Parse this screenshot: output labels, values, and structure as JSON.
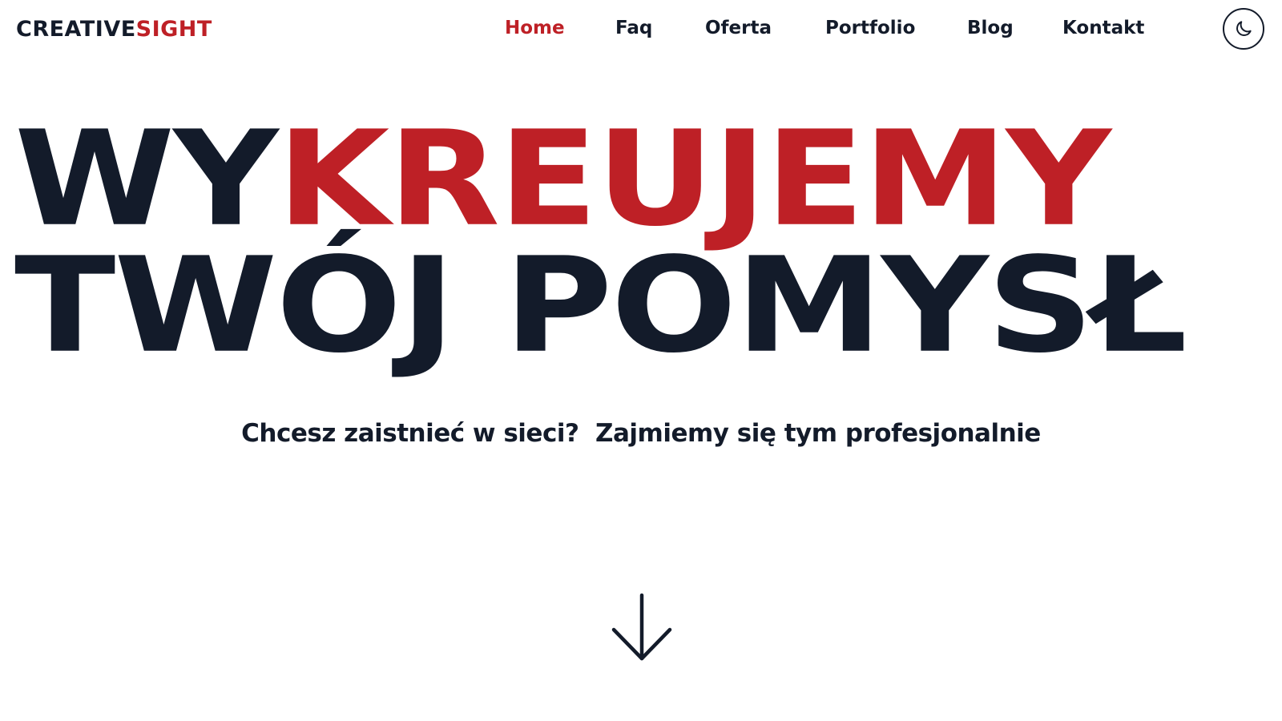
{
  "header": {
    "logo": {
      "part1": "CREATIVE",
      "part2": "SIGHT"
    },
    "nav": [
      {
        "label": "Home",
        "active": true
      },
      {
        "label": "Faq",
        "active": false
      },
      {
        "label": "Oferta",
        "active": false
      },
      {
        "label": "Portfolio",
        "active": false
      },
      {
        "label": "Blog",
        "active": false
      },
      {
        "label": "Kontakt",
        "active": false
      }
    ],
    "theme_toggle_icon": "moon-icon"
  },
  "hero": {
    "line1_prefix": "WY",
    "line1_accent": "KREUJEMY",
    "line2": "TWÓJ POMYSŁ",
    "subtitle": "Chcesz zaistnieć w sieci?  Zajmiemy się tym profesjonalnie"
  },
  "scroll_icon": "arrow-down-icon",
  "colors": {
    "text": "#131b2a",
    "accent": "#be2026",
    "background": "#ffffff"
  }
}
